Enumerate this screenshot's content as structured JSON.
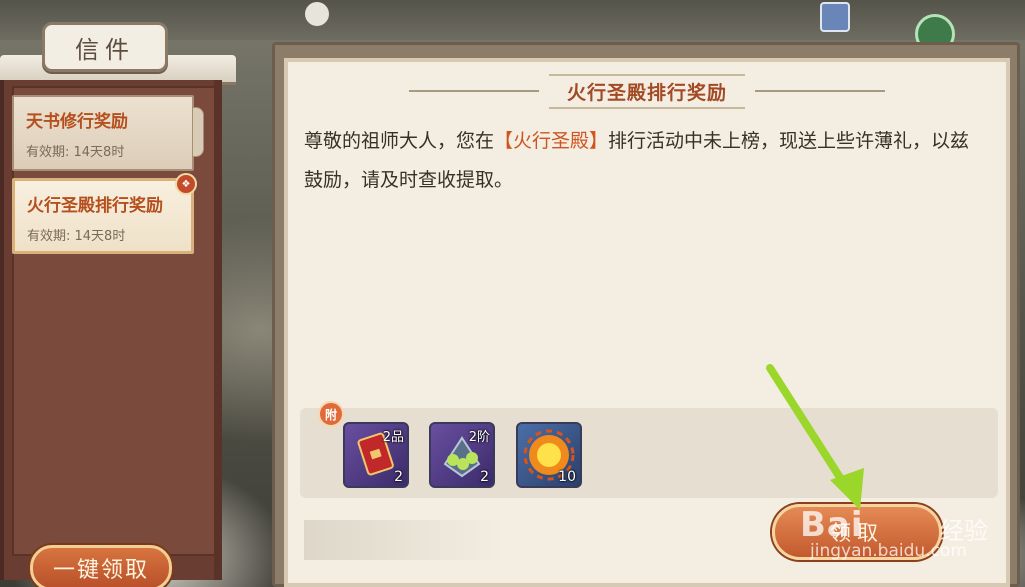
{
  "window": {
    "title": "信件"
  },
  "sidebar": {
    "items": [
      {
        "label": "天书修行奖励",
        "expiry": "有效期: 14天8时",
        "selected": false,
        "has_attachment": false
      },
      {
        "label": "火行圣殿排行奖励",
        "expiry": "有效期: 14天8时",
        "selected": true,
        "has_attachment": true
      }
    ],
    "claim_all_label": "一键领取"
  },
  "letter": {
    "title": "火行圣殿排行奖励",
    "body_before": "尊敬的祖师大人，您在",
    "body_highlight": "【火行圣殿】",
    "body_after": "排行活动中未上榜，现送上些许薄礼，以兹鼓励，请及时查收提取。",
    "attachment_tag": "附",
    "attachments": [
      {
        "icon": "red-scroll-icon",
        "quality": "2品",
        "count": "2"
      },
      {
        "icon": "green-orb-artifact-icon",
        "quality": "2阶",
        "count": "2"
      },
      {
        "icon": "fire-orb-icon",
        "quality": "",
        "count": "10"
      }
    ],
    "claim_label": "领取"
  },
  "overlay": {
    "watermark_brand": "Bai",
    "watermark_brand_cn": "经验",
    "watermark_url": "jingyan.baidu.com"
  },
  "colors": {
    "accent": "#c35a2e",
    "highlight_text": "#d0541f",
    "panel_brown": "#6a3d32",
    "paper": "#f4eee2",
    "annotation_arrow": "#9bd62a"
  }
}
